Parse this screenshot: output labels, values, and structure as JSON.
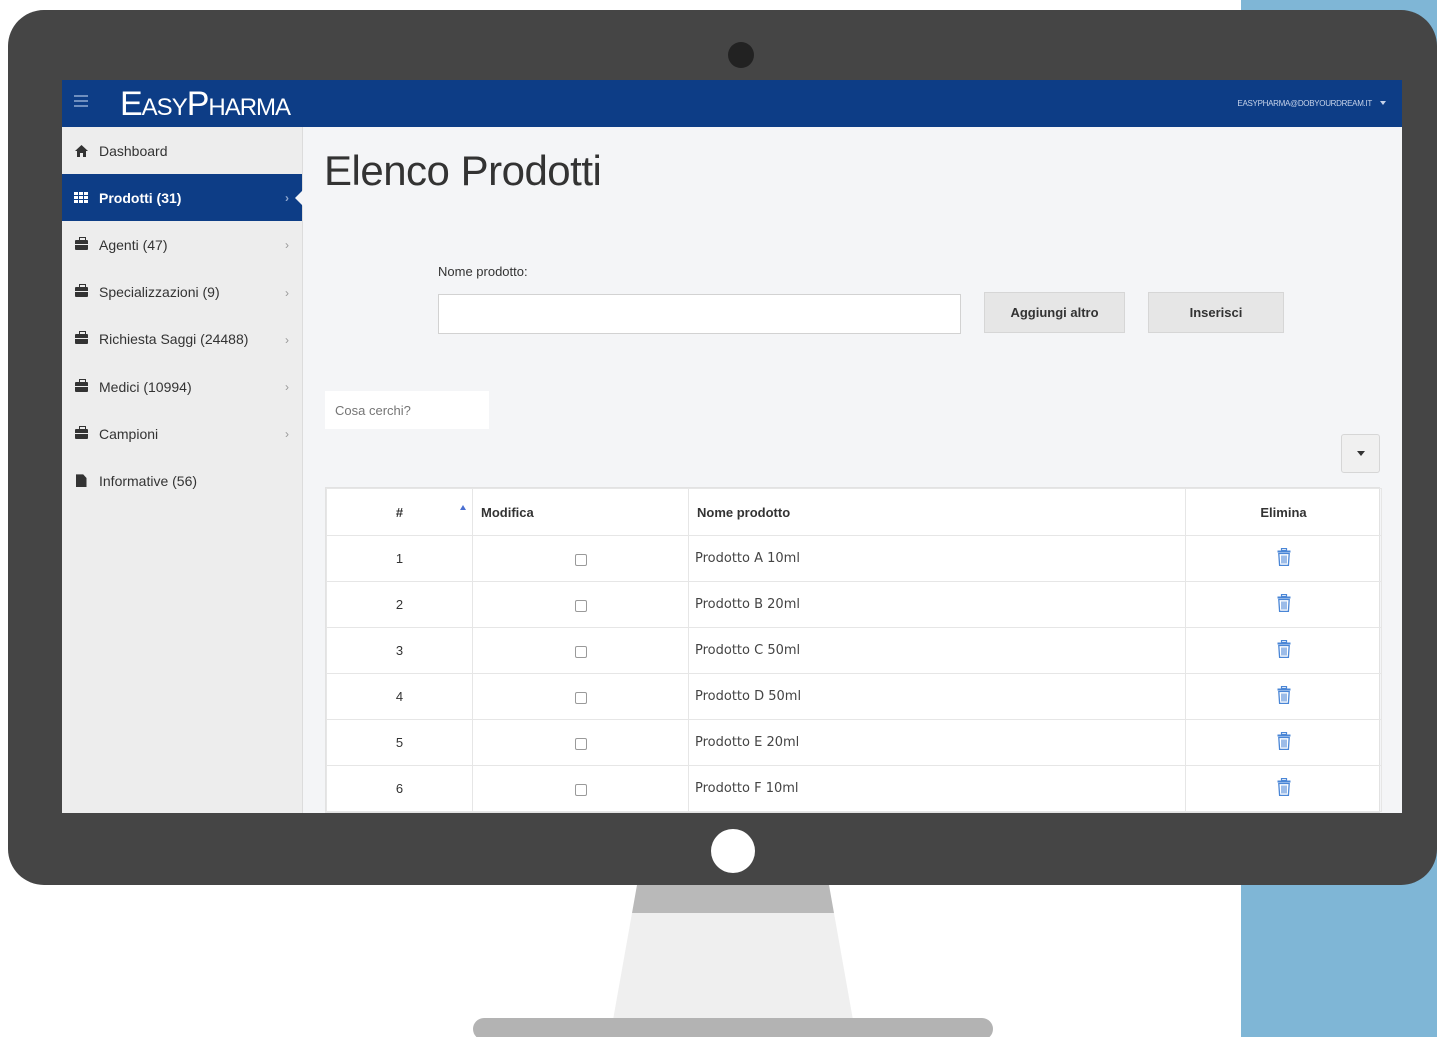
{
  "app": {
    "logo": "EasyPharma",
    "user_email": "EASYPHARMA@DOBYOURDREAM.IT"
  },
  "sidebar": {
    "items": [
      {
        "label": "Dashboard",
        "icon": "home-icon",
        "active": false,
        "chevron": false
      },
      {
        "label": "Prodotti (31)",
        "icon": "grid-icon",
        "active": true,
        "chevron": true
      },
      {
        "label": "Agenti (47)",
        "icon": "briefcase-icon",
        "active": false,
        "chevron": true
      },
      {
        "label": "Specializzazioni (9)",
        "icon": "briefcase-icon",
        "active": false,
        "chevron": true
      },
      {
        "label": "Richiesta Saggi (24488)",
        "icon": "briefcase-icon",
        "active": false,
        "chevron": true
      },
      {
        "label": "Medici (10994)",
        "icon": "briefcase-icon",
        "active": false,
        "chevron": true
      },
      {
        "label": "Campioni",
        "icon": "briefcase-icon",
        "active": false,
        "chevron": true
      },
      {
        "label": "Informative (56)",
        "icon": "file-icon",
        "active": false,
        "chevron": false
      }
    ]
  },
  "main": {
    "title": "Elenco Prodotti",
    "form": {
      "label": "Nome prodotto:",
      "value": "",
      "add_button": "Aggiungi altro",
      "insert_button": "Inserisci"
    },
    "search": {
      "placeholder": "Cosa cerchi?"
    },
    "table": {
      "headers": {
        "num": "#",
        "edit": "Modifica",
        "name": "Nome prodotto",
        "delete": "Elimina"
      },
      "rows": [
        {
          "num": "1",
          "name": "Prodotto A 10ml"
        },
        {
          "num": "2",
          "name": "Prodotto B 20ml"
        },
        {
          "num": "3",
          "name": "Prodotto C 50ml"
        },
        {
          "num": "4",
          "name": "Prodotto D 50ml"
        },
        {
          "num": "5",
          "name": "Prodotto E 20ml"
        },
        {
          "num": "6",
          "name": "Prodotto F 10ml"
        }
      ]
    }
  },
  "colors": {
    "brand": "#0d3d86",
    "trash": "#4a86d6",
    "accent_strip": "#7fb6d6"
  }
}
